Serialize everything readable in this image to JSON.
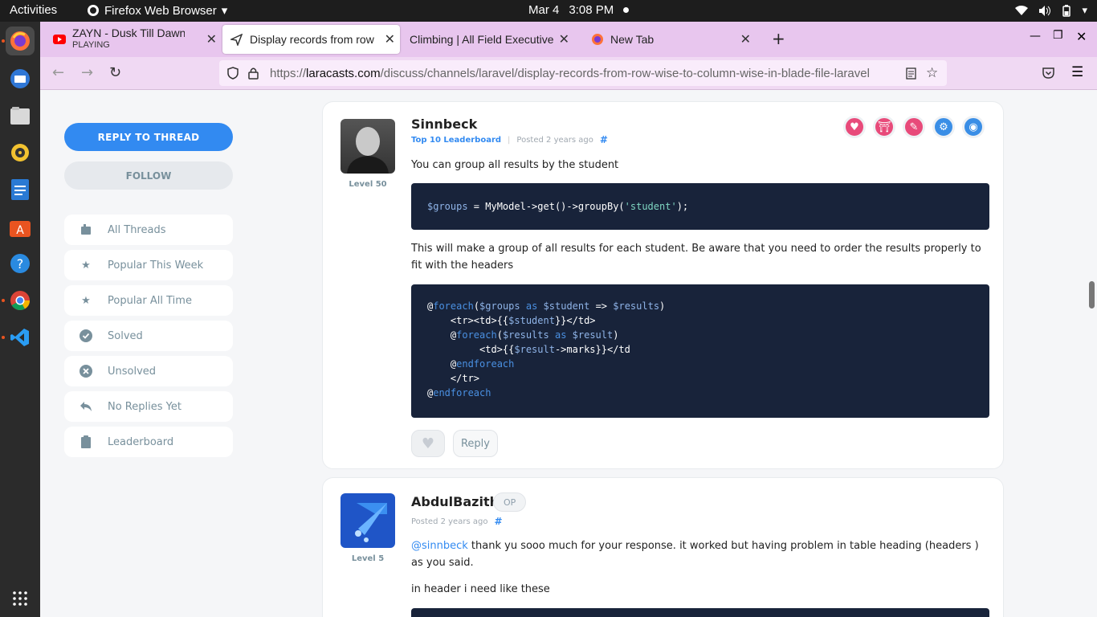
{
  "topbar": {
    "activities": "Activities",
    "app_name": "Firefox Web Browser",
    "date": "Mar 4",
    "time": "3:08 PM"
  },
  "dock": {
    "items": [
      "firefox-icon",
      "thunderbird-icon",
      "files-icon",
      "rhythmbox-icon",
      "writer-icon",
      "software-icon",
      "help-icon",
      "chrome-icon",
      "vscode-icon"
    ],
    "apps_grid": "show-apps-icon"
  },
  "tabs": [
    {
      "title": "ZAYN - Dusk Till Dawn (Of",
      "subtitle": "PLAYING",
      "icon": "youtube-icon"
    },
    {
      "title": "Display records from row",
      "icon": "laracasts-icon"
    },
    {
      "title": "Climbing | All Field Executive",
      "icon": ""
    },
    {
      "title": "New Tab",
      "icon": "firefox-icon"
    }
  ],
  "url": {
    "prefix": "https://",
    "domain": "laracasts.com",
    "path": "/discuss/channels/laravel/display-records-from-row-wise-to-column-wise-in-blade-file-laravel"
  },
  "sidebar": {
    "reply_button": "REPLY TO THREAD",
    "follow_button": "FOLLOW",
    "items": [
      {
        "label": "All Threads",
        "icon": "threads-icon"
      },
      {
        "label": "Popular This Week",
        "icon": "star-icon"
      },
      {
        "label": "Popular All Time",
        "icon": "star-icon"
      },
      {
        "label": "Solved",
        "icon": "check-circle-icon"
      },
      {
        "label": "Unsolved",
        "icon": "x-circle-icon"
      },
      {
        "label": "No Replies Yet",
        "icon": "reply-arrow-icon"
      },
      {
        "label": "Leaderboard",
        "icon": "clipboard-icon"
      }
    ]
  },
  "posts": [
    {
      "author": "Sinnbeck",
      "level": "Level 50",
      "rank": "Top 10 Leaderboard",
      "posted": "Posted 2 years ago",
      "hash": "#",
      "text1": "You can group all results by the student",
      "text2": "This will make a group of all results for each student. Be aware that you need to order the results properly to fit with the headers",
      "reply_label": "Reply",
      "badge_colors": [
        "#e84a7a",
        "#e84a7a",
        "#e84a7a",
        "#3a8ee6",
        "#3a8ee6"
      ]
    },
    {
      "author": "AbdulBazith",
      "op": "OP",
      "level": "Level 5",
      "posted": "Posted 2 years ago",
      "hash": "#",
      "mention": "@sinnbeck",
      "text1": " thank yu sooo much for your response. it worked but having problem in table heading (headers ) as you said.",
      "text2": "in header i need like these"
    }
  ],
  "code1": {
    "var": "$groups",
    "mid": " = MyModel->get()->groupBy(",
    "str": "'student'",
    "end": ");"
  }
}
